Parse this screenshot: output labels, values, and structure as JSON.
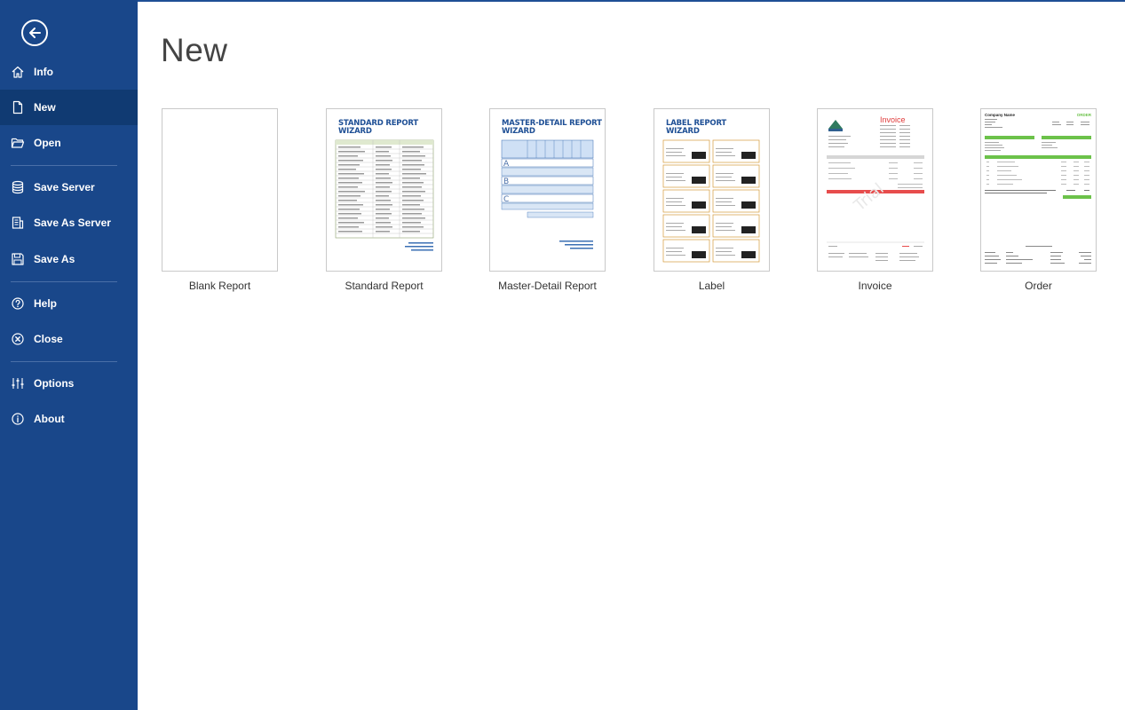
{
  "sidebar": {
    "back_label": "Back",
    "items": [
      {
        "label": "Info",
        "icon": "home-icon"
      },
      {
        "label": "New",
        "icon": "document-icon"
      },
      {
        "label": "Open",
        "icon": "folder-open-icon"
      },
      {
        "label": "Save Server",
        "icon": "database-icon"
      },
      {
        "label": "Save As Server",
        "icon": "server-save-icon"
      },
      {
        "label": "Save As",
        "icon": "floppy-disk-icon"
      },
      {
        "label": "Help",
        "icon": "question-circle-icon"
      },
      {
        "label": "Close",
        "icon": "close-circle-icon"
      },
      {
        "label": "Options",
        "icon": "sliders-icon"
      },
      {
        "label": "About",
        "icon": "info-circle-icon"
      }
    ],
    "active": "New"
  },
  "main": {
    "title": "New",
    "templates": [
      {
        "label": "Blank Report"
      },
      {
        "label": "Standard Report",
        "thumb_title_1": "STANDARD REPORT",
        "thumb_title_2": "WIZARD"
      },
      {
        "label": "Master-Detail Report",
        "thumb_title_1": "MASTER-DETAIL REPORT",
        "thumb_title_2": "WIZARD"
      },
      {
        "label": "Label",
        "thumb_title_1": "LABEL REPORT",
        "thumb_title_2": "WIZARD"
      },
      {
        "label": "Invoice",
        "thumb_title_1": "Invoice"
      },
      {
        "label": "Order",
        "thumb_title_1": "Company Name",
        "thumb_title_2": "ORDER"
      }
    ]
  },
  "colors": {
    "sidebar_bg": "#19478a",
    "sidebar_active": "#103a72",
    "accent": "#1e4f95"
  }
}
